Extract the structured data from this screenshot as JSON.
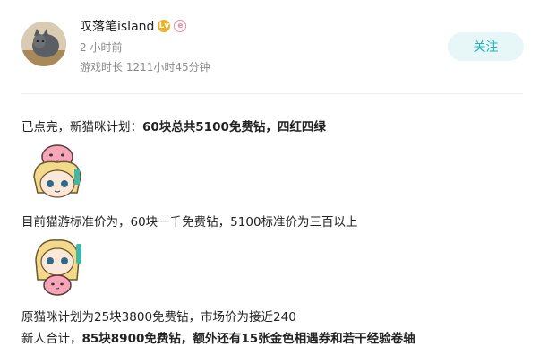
{
  "user": {
    "name": "叹落笔island",
    "badge_level": "Lv",
    "badge_second": "e",
    "post_time": "2 小时前",
    "play_time": "游戏时长 1211小时45分钟",
    "follow_label": "关注"
  },
  "post": {
    "line1_prefix": "已点完，新猫咪计划：",
    "line1_bold": "60块总共5100免费钻，四红四绿",
    "line2": "目前猫游标准价为，60块一千免费钻，5100标准价为三百以上",
    "line3": "原猫咪计划为25块3800免费钻，市场价为接近240",
    "line4_prefix": "新人合计，",
    "line4_bold": "85块8900免费钻，额外还有15张金色相遇券和若干经验卷轴"
  },
  "colors": {
    "accent": "#20b2bf",
    "follow_bg": "#e7f7f8",
    "muted_text": "#8a8a8a"
  }
}
